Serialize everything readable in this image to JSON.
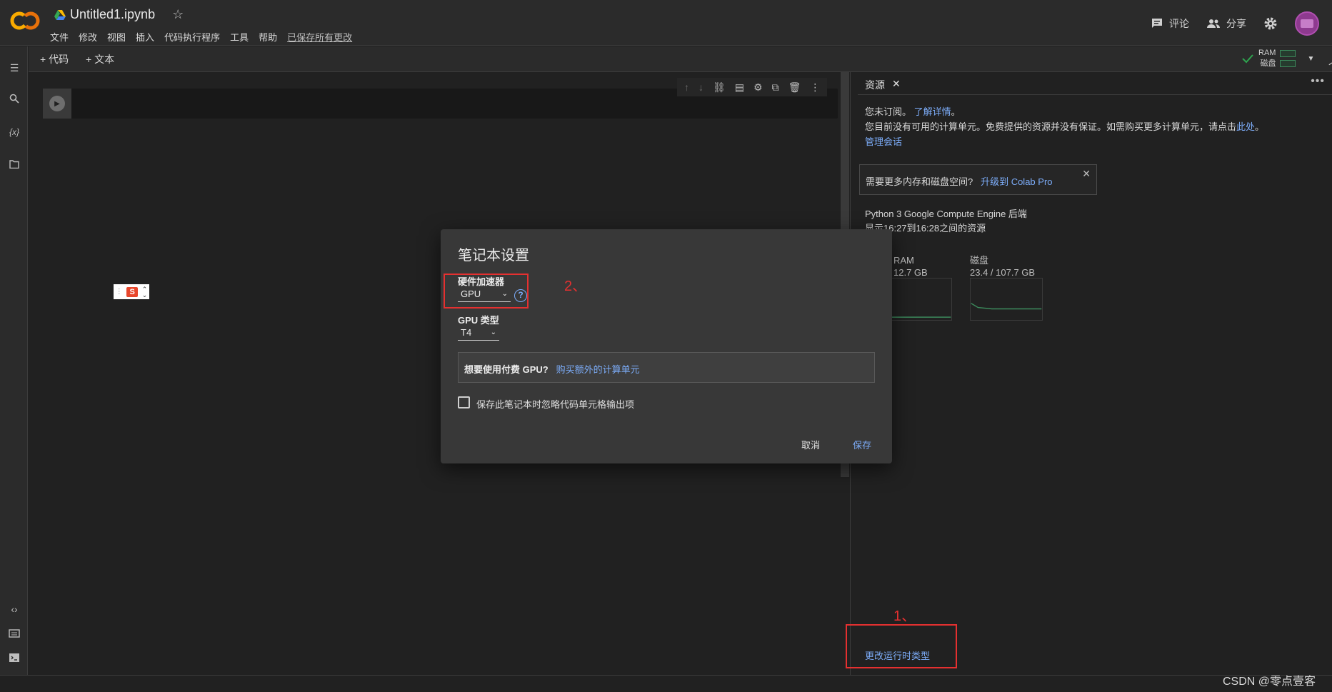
{
  "header": {
    "title": "Untitled1.ipynb",
    "menu": [
      "文件",
      "修改",
      "视图",
      "插入",
      "代码执行程序",
      "工具",
      "帮助"
    ],
    "saved_status": "已保存所有更改",
    "comment_label": "评论",
    "share_label": "分享"
  },
  "toolbar": {
    "add_code": "+ 代码",
    "add_text": "+ 文本",
    "ram_label": "RAM",
    "disk_label": "磁盘"
  },
  "panel": {
    "tab_label": "资源",
    "not_subscribed": "您未订阅。",
    "learn_more": "了解详情",
    "period": "。",
    "no_units": "您目前没有可用的计算单元。免费提供的资源并没有保证。如需购买更多计算单元，请点击",
    "here_link": "此处",
    "manage_sessions": "管理会话",
    "upsell_text": "需要更多内存和磁盘空间?",
    "upsell_link": "升级到 Colab Pro",
    "backend": "Python 3 Google Compute Engine 后端",
    "time_range": "显示16:27到16:28之间的资源",
    "ram_graph_label": "RAM",
    "ram_value": "12.7 GB",
    "disk_graph_label": "磁盘",
    "disk_value": "23.4 / 107.7 GB",
    "change_runtime": "更改运行时类型"
  },
  "dialog": {
    "title": "笔记本设置",
    "hw_label": "硬件加速器",
    "hw_value": "GPU",
    "gpu_type_label": "GPU 类型",
    "gpu_type_value": "T4",
    "paid_question": "想要使用付费 GPU?",
    "paid_link": "购买额外的计算单元",
    "omit_output": "保存此笔记本时忽略代码单元格输出项",
    "cancel": "取消",
    "save": "保存"
  },
  "annotations": {
    "step1": "1、",
    "step2": "2、"
  },
  "watermark": "CSDN @零点壹客",
  "colors": {
    "link": "#7cacf8",
    "annotation": "#e53030",
    "dialog_bg": "#383838",
    "app_bg": "#212121"
  }
}
